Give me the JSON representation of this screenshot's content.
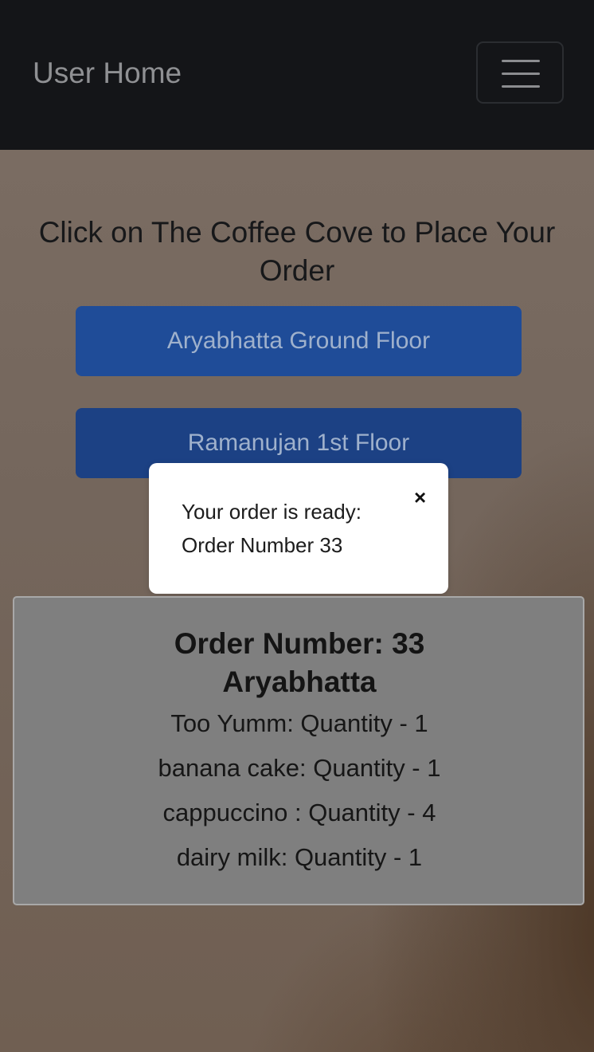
{
  "navbar": {
    "brand": "User Home",
    "toggle_icon": "hamburger-icon"
  },
  "main": {
    "heading": "Click on The Coffee Cove to Place Your Order",
    "locations": [
      "Aryabhatta Ground Floor",
      "Ramanujan 1st Floor"
    ]
  },
  "toast": {
    "message": "Your order is ready: Order Number 33",
    "close_label": "×"
  },
  "order": {
    "number_label": "Order Number: 33",
    "location": "Aryabhatta",
    "items": [
      "Too Yumm: Quantity - 1",
      "banana cake: Quantity - 1",
      "cappuccino : Quantity - 4",
      "dairy milk: Quantity - 1"
    ]
  },
  "colors": {
    "navbar_bg": "#141518",
    "button_bg": "#1f4c98",
    "card_bg": "#7f7f7f"
  }
}
